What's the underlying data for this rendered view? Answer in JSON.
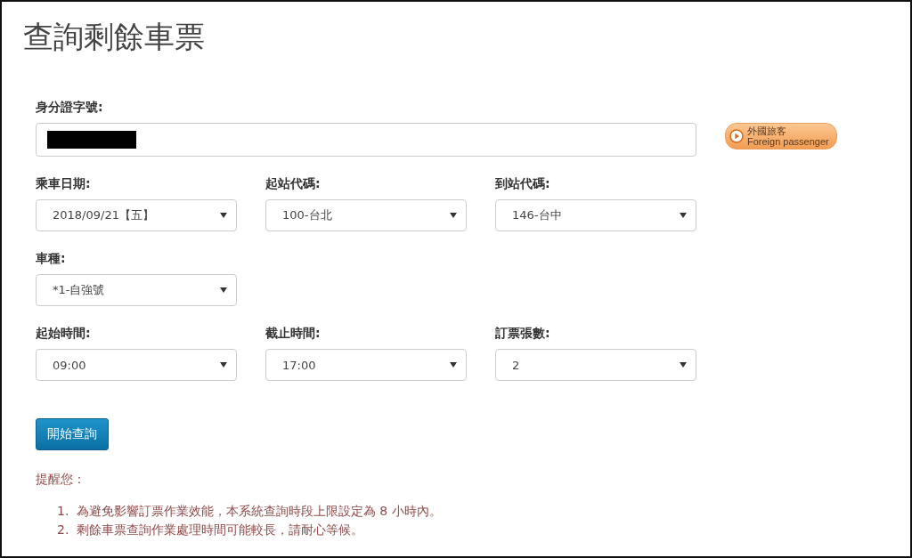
{
  "title": "查詢剩餘車票",
  "id_field": {
    "label": "身分證字號:",
    "redacted": true
  },
  "foreign_button": {
    "line_1": "外國旅客",
    "line_2": "Foreign passenger"
  },
  "form_rows": [
    [
      {
        "label": "乘車日期:",
        "value": "2018/09/21【五】"
      },
      {
        "label": "起站代碼:",
        "value": "100-台北"
      },
      {
        "label": "到站代碼:",
        "value": "146-台中"
      }
    ],
    [
      {
        "label": "車種:",
        "value": "*1-自強號"
      }
    ],
    [
      {
        "label": "起始時間:",
        "value": "09:00"
      },
      {
        "label": "截止時間:",
        "value": "17:00"
      },
      {
        "label": "訂票張數:",
        "value": "2"
      }
    ]
  ],
  "submit_button": "開始查詢",
  "reminder": {
    "heading": "提醒您：",
    "items": [
      {
        "number": "1.",
        "text": "為避免影響訂票作業效能，本系統查詢時段上限設定為 8 小時內。"
      },
      {
        "number": "2.",
        "text": "剩餘車票查詢作業處理時間可能較長，請耐心等候。"
      }
    ]
  }
}
